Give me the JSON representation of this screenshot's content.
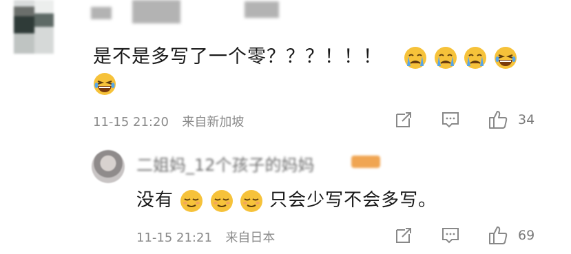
{
  "main_comment": {
    "text_prefix": "是不是多写了一个零？？？！！！",
    "emojis_line1": [
      "crying-face-icon",
      "crying-face-icon",
      "crying-face-icon",
      "laughing-face-icon"
    ],
    "emojis_line2": [
      "laughing-face-icon"
    ],
    "timestamp": "11-15 21:20",
    "location": "来自新加坡",
    "like_count": "34"
  },
  "reply": {
    "username": "二姐妈_12个孩子的妈妈",
    "text_prefix": "没有",
    "emojis": [
      "smirk-face-icon",
      "smirk-face-icon",
      "smirk-face-icon"
    ],
    "text_suffix": "只会少写不会多写。",
    "timestamp": "11-15 21:21",
    "location": "来自日本",
    "like_count": "69"
  },
  "colors": {
    "meta_text": "#8a8a8a",
    "emoji_yellow": "#f6c23a",
    "tear_blue": "#56a5e8"
  }
}
